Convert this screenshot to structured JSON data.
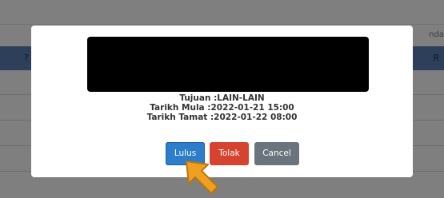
{
  "background": {
    "top_peek_text": "nda",
    "header_left": "?",
    "header_right": "R"
  },
  "modal": {
    "info": {
      "purpose": "Tujuan :LAIN-LAIN",
      "start": "Tarikh Mula :2022-01-21 15:00",
      "end": "Tarikh Tamat :2022-01-22 08:00"
    },
    "buttons": {
      "approve_label": "Lulus",
      "reject_label": "Tolak",
      "cancel_label": "Cancel"
    }
  },
  "colors": {
    "approve": "#2c7dca",
    "reject": "#d64430",
    "cancel": "#6b747c",
    "cursor": "#f0a020"
  },
  "cursor_icon": "arrow-cursor-icon"
}
